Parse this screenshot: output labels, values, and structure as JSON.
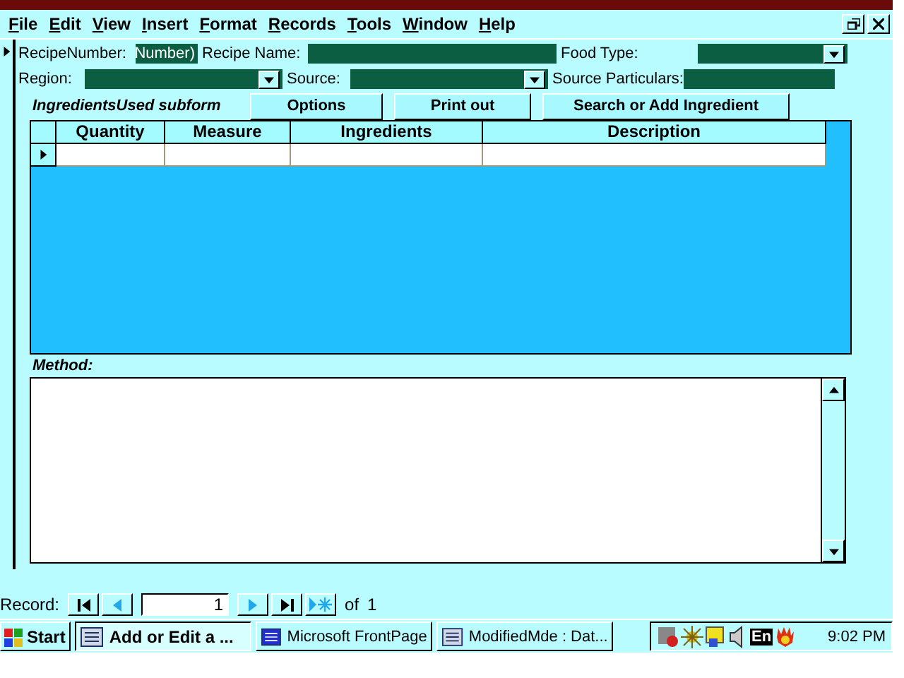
{
  "menu": [
    "File",
    "Edit",
    "View",
    "Insert",
    "Format",
    "Records",
    "Tools",
    "Window",
    "Help"
  ],
  "header_rows": [
    [
      {
        "kind": "text",
        "label": "RecipeNumber:",
        "value": "Number)"
      },
      {
        "kind": "text",
        "label": "Recipe Name:"
      },
      {
        "kind": "combo",
        "label": "Food Type:"
      }
    ],
    [
      {
        "kind": "combo",
        "label": "Region:"
      },
      {
        "kind": "combo",
        "label": "Source:"
      },
      {
        "kind": "text",
        "label": "Source Particulars:"
      }
    ]
  ],
  "subform": {
    "title": "IngredientsUsed subform",
    "buttons": [
      "Options",
      "Print out",
      "Search or Add Ingredient"
    ],
    "columns": [
      "Quantity",
      "Measure",
      "Ingredients",
      "Description"
    ]
  },
  "method": {
    "label": "Method:"
  },
  "navigator": {
    "label": "Record:",
    "value": "1",
    "of": "of",
    "total": "1"
  },
  "taskbar": {
    "start": "Start",
    "tasks": [
      {
        "label": "Add or Edit a ...",
        "selected": true
      },
      {
        "label": "Microsoft FrontPage",
        "selected": false
      },
      {
        "label": "ModifiedMde : Dat...",
        "selected": false
      }
    ],
    "language": "En",
    "clock": "9:02 PM"
  }
}
